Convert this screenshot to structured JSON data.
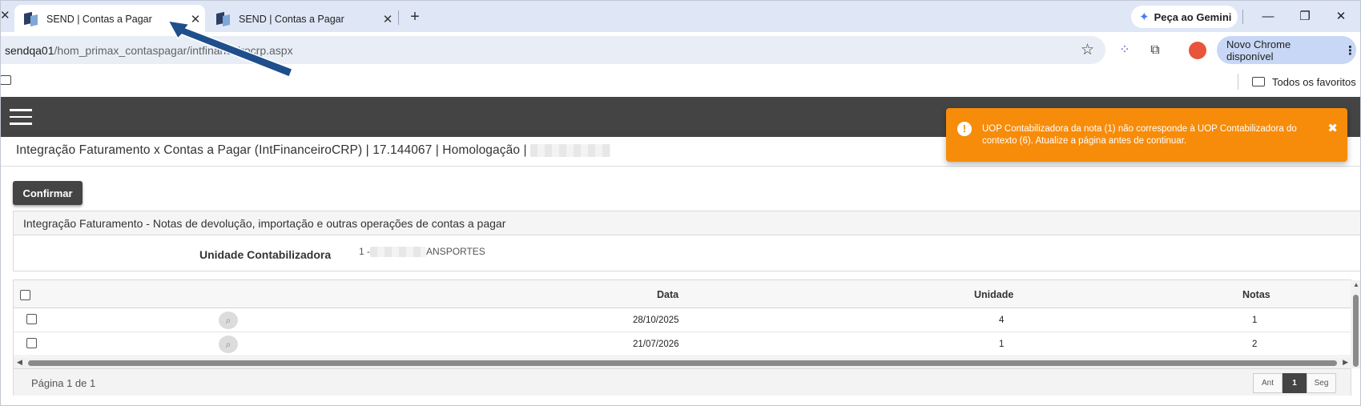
{
  "browser": {
    "tabs": [
      {
        "title": "SEND | Contas a Pagar",
        "active": true
      },
      {
        "title": "SEND | Contas a Pagar",
        "active": false
      }
    ],
    "gemini_label": "Peça ao Gemini",
    "url_host": "sendqa01",
    "url_path": "/hom_primax_contaspagar/intfinanceirocrp.aspx",
    "update_label": "Novo Chrome disponível",
    "bookmarks_all": "Todos os favoritos"
  },
  "page": {
    "title": "Integração Faturamento x Contas a Pagar (IntFinanceiroCRP) | 17.144067 | Homologação |",
    "confirm_label": "Confirmar",
    "panel_title": "Integração Faturamento - Notas de devolução, importação e outras operações de contas a pagar",
    "unit_label": "Unidade Contabilizadora",
    "unit_value_prefix": "1 -",
    "unit_value_suffix": "ANSPORTES"
  },
  "grid": {
    "columns": {
      "data": "Data",
      "unidade": "Unidade",
      "notas": "Notas"
    },
    "rows": [
      {
        "data": "28/10/2025",
        "unidade": "4",
        "notas": "1"
      },
      {
        "data": "21/07/2026",
        "unidade": "1",
        "notas": "2"
      }
    ],
    "page_info": "Página 1 de 1",
    "pager": {
      "prev": "Ant",
      "current": "1",
      "next": "Seg"
    }
  },
  "toast": {
    "message": "UOP Contabilizadora da nota (1) não corresponde à UOP Contabilizadora do contexto (6). Atualize a página antes de continuar.",
    "color": "#f78c0a"
  },
  "colors": {
    "app_header": "#444444",
    "tabstrip": "#dfe7f7",
    "annotation_arrow": "#1e4f8c"
  }
}
